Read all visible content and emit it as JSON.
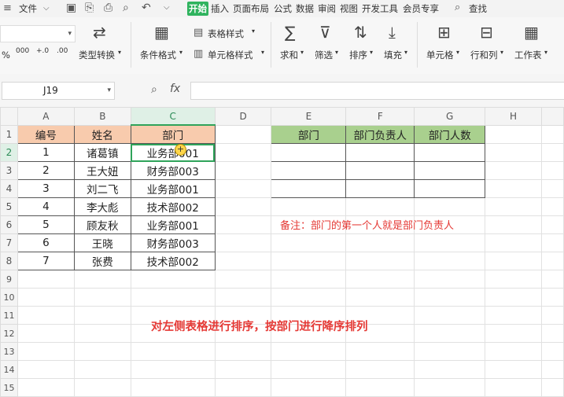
{
  "menubar": {
    "file_label": "文件",
    "tabs": [
      "开始",
      "插入",
      "页面布局",
      "公式",
      "数据",
      "审阅",
      "视图",
      "开发工具",
      "会员专享"
    ],
    "search_label": "查找"
  },
  "ribbon": {
    "convert_label": "类型转换",
    "cond_format_label": "条件格式",
    "table_style_label": "表格样式",
    "cell_style_label": "单元格样式",
    "sum_label": "求和",
    "filter_label": "筛选",
    "sort_label": "排序",
    "fill_label": "填充",
    "cell_label": "单元格",
    "rowcol_label": "行和列",
    "sheet_label": "工作表",
    "percent_glyph": "%",
    "thousands_glyph": "000",
    "dec_inc_glyph": "+.0",
    "dec_dec_glyph": ".00"
  },
  "formula_bar": {
    "cell_ref": "J19",
    "fx_label": "fx",
    "formula": ""
  },
  "sheet": {
    "columns": [
      "A",
      "B",
      "C",
      "D",
      "E",
      "F",
      "G",
      "H"
    ],
    "rows": [
      "1",
      "2",
      "3",
      "4",
      "5",
      "6",
      "7",
      "8",
      "9",
      "10",
      "11",
      "12",
      "13",
      "14",
      "15"
    ],
    "left_headers": [
      "编号",
      "姓名",
      "部门"
    ],
    "left_rows": [
      [
        "1",
        "诸葛镇",
        "业务部001"
      ],
      [
        "2",
        "王大妞",
        "财务部003"
      ],
      [
        "3",
        "刘二飞",
        "业务部001"
      ],
      [
        "4",
        "李大彪",
        "技术部002"
      ],
      [
        "5",
        "顾友秋",
        "业务部001"
      ],
      [
        "6",
        "王晓",
        "财务部003"
      ],
      [
        "7",
        "张费",
        "技术部002"
      ]
    ],
    "right_headers": [
      "部门",
      "部门负责人",
      "部门人数"
    ]
  },
  "notes": {
    "remark": "备注：部门的第一个人就是部门负责人",
    "instruction": "对左侧表格进行排序，按部门进行降序排列"
  }
}
